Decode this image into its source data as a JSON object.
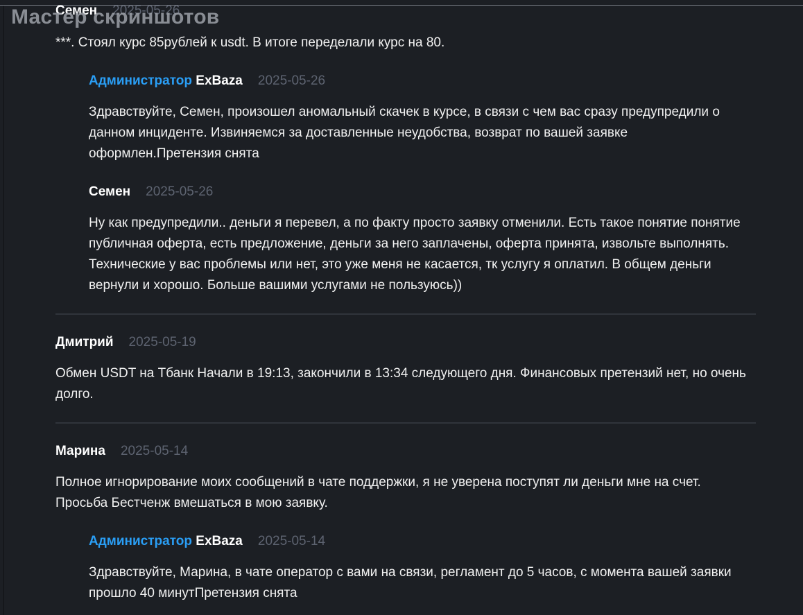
{
  "watermark": "Мастер скриншотов",
  "reviews": [
    {
      "author": "Семен",
      "date": "2025-05-26",
      "text": "***. Стоял курс 85рублей к usdt. В итоге переделали курс на 80.",
      "replies": [
        {
          "role": "Администратор",
          "author": "ExBaza",
          "date": "2025-05-26",
          "text": "Здравствуйте, Семен, произошел аномальный скачек в курсе, в связи с чем вас сразу предупредили о данном инциденте. Извиняемся за доставленные неудобства, возврат по вашей заявке оформлен.Претензия снята"
        },
        {
          "author": "Семен",
          "date": "2025-05-26",
          "text": "Ну как предупредили.. деньги я перевел, а по факту просто заявку отменили. Есть такое понятие понятие публичная оферта, есть предложение, деньги за него заплачены, оферта принята, извольте выполнять. Технические у вас проблемы или нет, это уже меня не касается, тк услугу я оплатил. В общем деньги вернули и хорошо. Больше вашими услугами не пользуюсь))"
        }
      ]
    },
    {
      "author": "Дмитрий",
      "date": "2025-05-19",
      "text": "Обмен USDT на Тбанк Начали в 19:13, закончили в 13:34 следующего дня. Финансовых претензий нет, но очень долго."
    },
    {
      "author": "Марина",
      "date": "2025-05-14",
      "text": "Полное игнорирование моих сообщений в чате поддержки, я не уверена поступят ли деньги мне на счет. Просьба Бестченж вмешаться в мою заявку.",
      "replies": [
        {
          "role": "Администратор",
          "author": "ExBaza",
          "date": "2025-05-14",
          "text": "Здравствуйте, Марина, в чате оператор с вами на связи, регламент до 5 часов, с момента вашей заявки прошло 40 минутПретензия снята"
        }
      ]
    }
  ]
}
